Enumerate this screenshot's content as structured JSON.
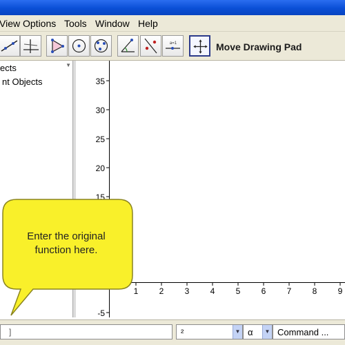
{
  "menubar": {
    "items": [
      "View",
      "Options",
      "Tools",
      "Window",
      "Help"
    ]
  },
  "toolbar": {
    "tools": [
      "line-tool-icon",
      "perpendicular-tool-icon",
      "polygon-tool-icon",
      "circle-tool-icon",
      "conic-tool-icon",
      "angle-tool-icon",
      "reflect-tool-icon",
      "slider-tool-icon",
      "move-drawing-pad-icon"
    ],
    "active_tool": "Move Drawing Pad"
  },
  "algebra_view": {
    "items": [
      "ects",
      "nt Objects"
    ]
  },
  "graphics_view": {
    "y_ticks": [
      "35",
      "30",
      "25",
      "20",
      "15",
      "-5"
    ],
    "x_ticks": [
      "1",
      "2",
      "3",
      "4",
      "5",
      "6",
      "7",
      "8",
      "9"
    ]
  },
  "callout": {
    "line1": "Enter the original",
    "line2": "function here.",
    "color": "#f9f02a"
  },
  "input_bar": {
    "input_value": "]",
    "symbol_combo": "²",
    "greek_combo": "α",
    "command_combo": "Command ..."
  }
}
